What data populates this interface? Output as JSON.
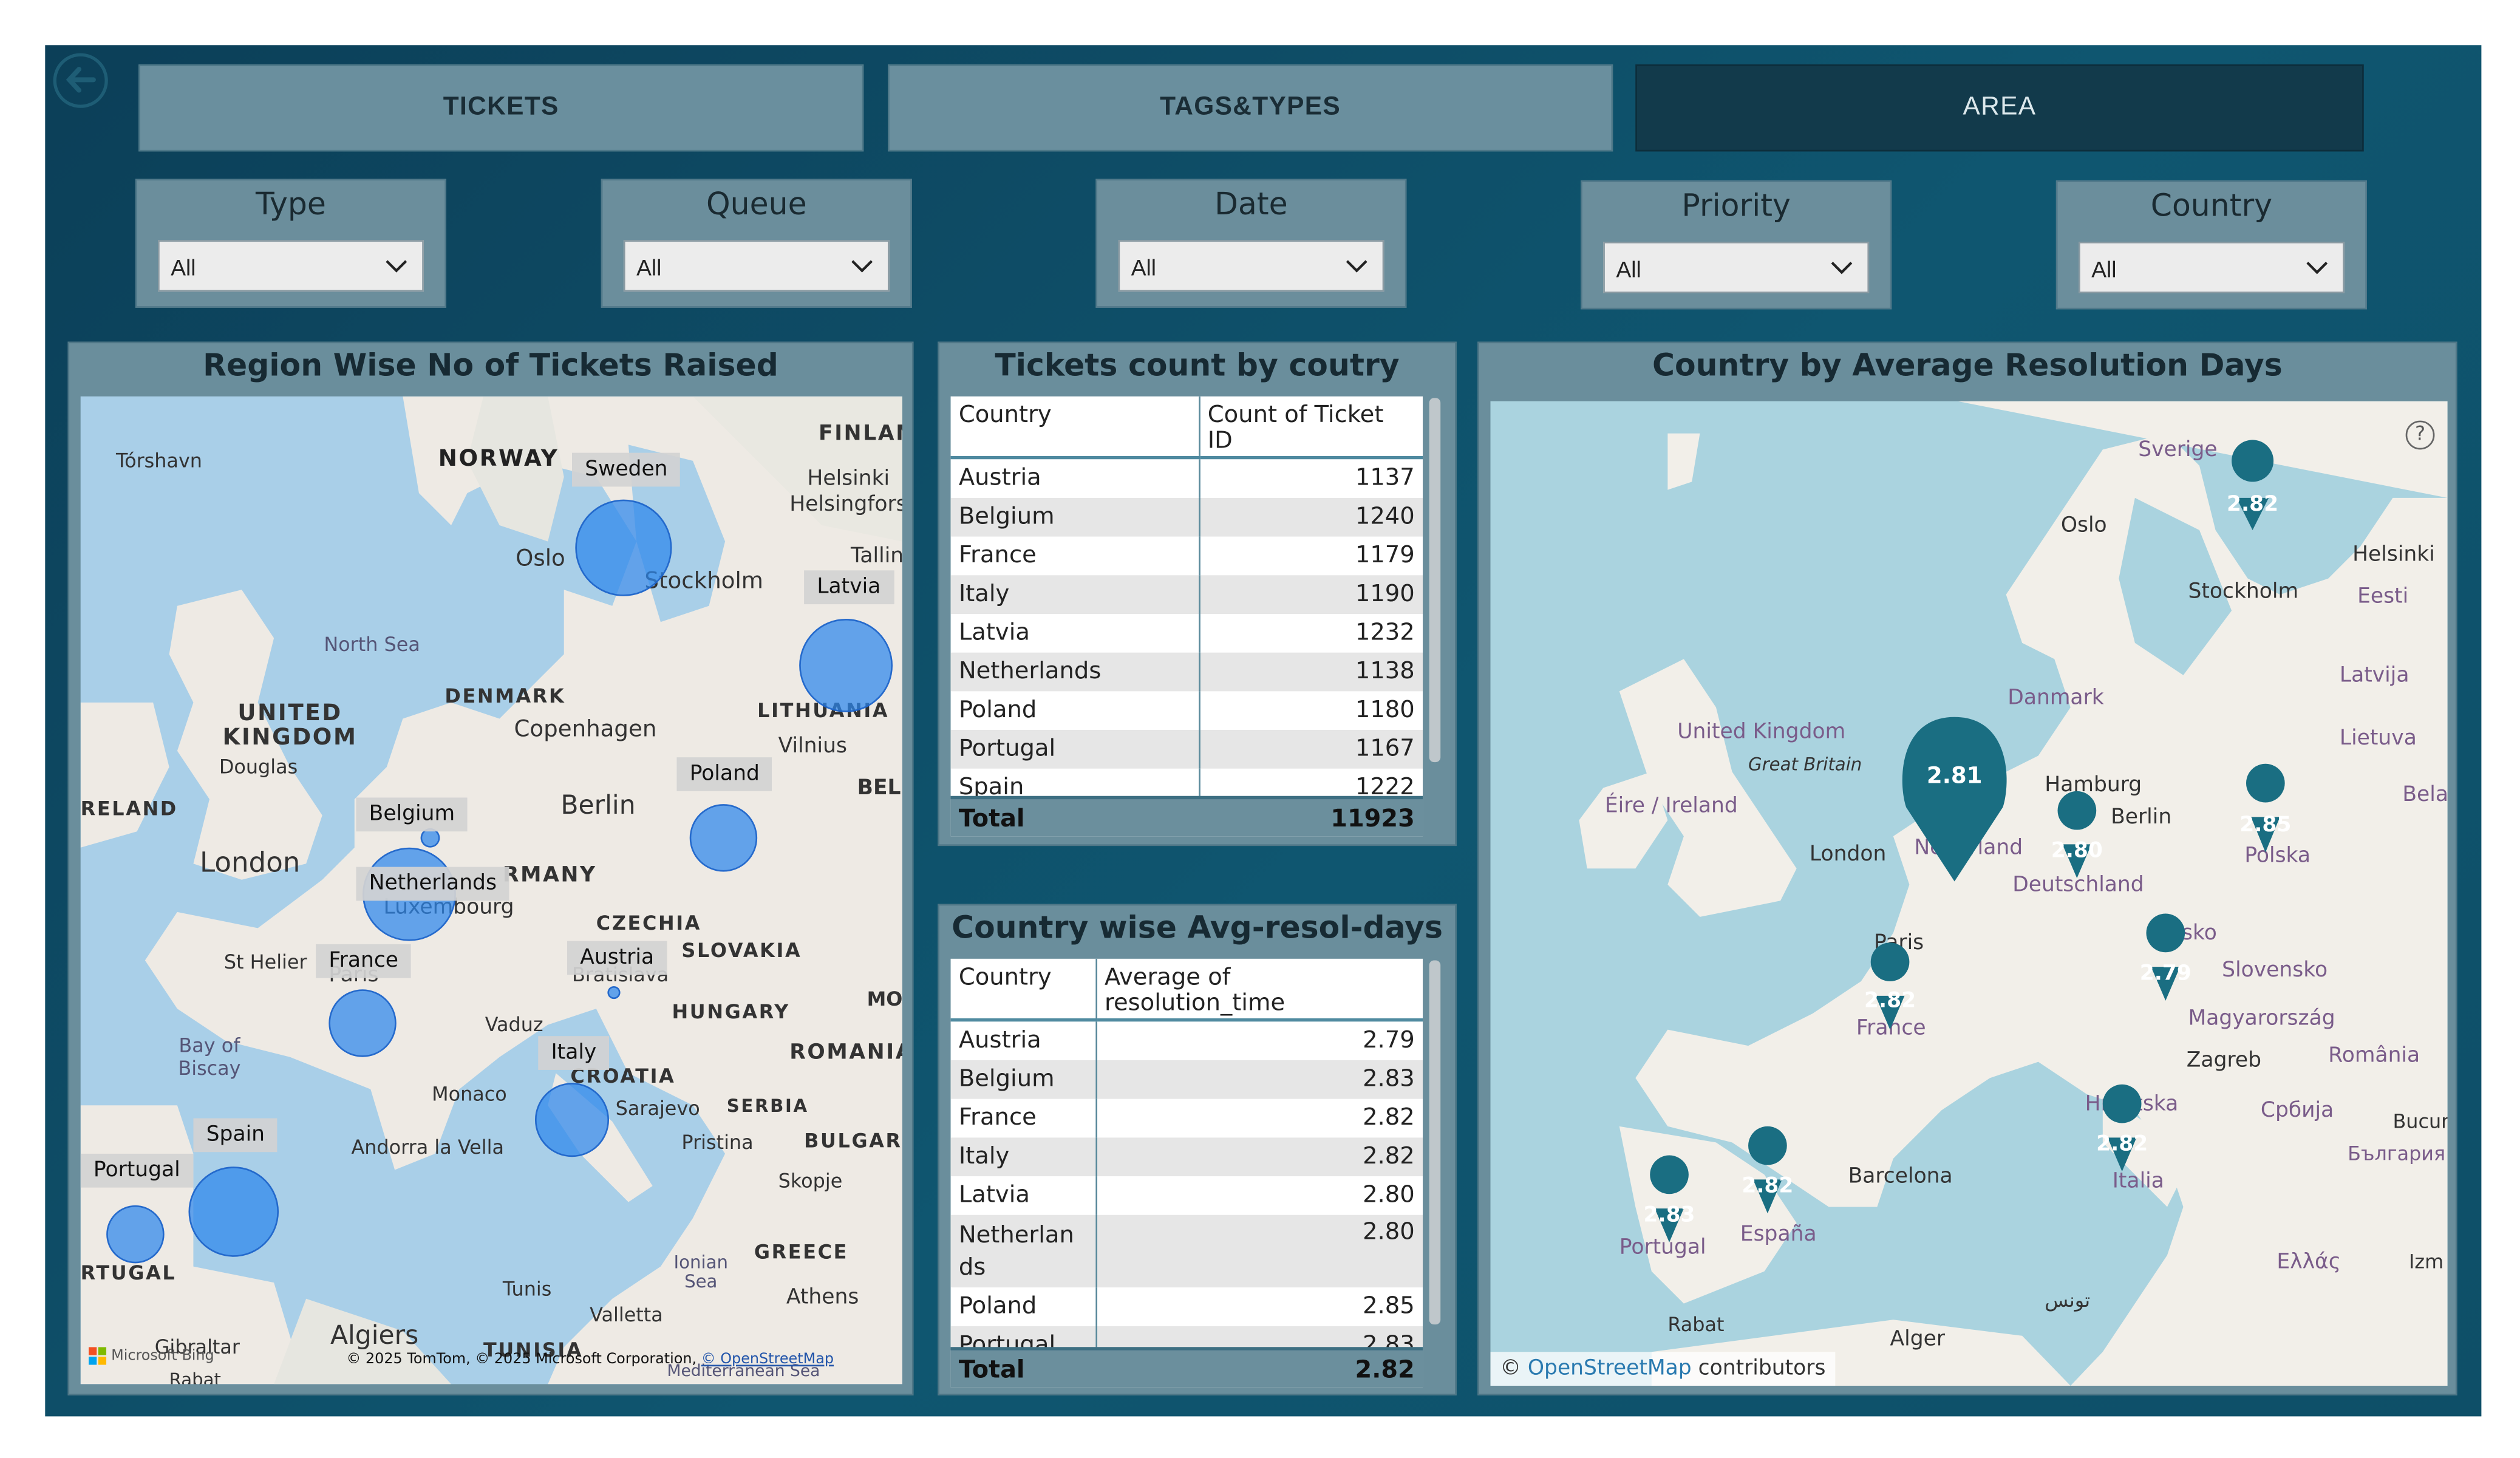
{
  "tabs": [
    {
      "label": "TICKETS",
      "active": false
    },
    {
      "label": "TAGS&TYPES",
      "active": false
    },
    {
      "label": "AREA",
      "active": true
    }
  ],
  "slicers": [
    {
      "title": "Type",
      "value": "All"
    },
    {
      "title": "Queue",
      "value": "All"
    },
    {
      "title": "Date",
      "value": "All"
    },
    {
      "title": "Priority",
      "value": "All"
    },
    {
      "title": "Country",
      "value": "All"
    }
  ],
  "region_map": {
    "title": "Region Wise No of Tickets Raised",
    "attribution": "© 2025 TomTom, © 2025 Microsoft Corporation,",
    "attribution_link": "© OpenStreetMap",
    "brand": "Microsoft Bing",
    "country_tags": [
      "Sweden",
      "Latvia",
      "Poland",
      "Belgium",
      "Netherlands",
      "France",
      "Austria",
      "Italy",
      "Spain",
      "Portugal"
    ],
    "place_labels": [
      "Tórshavn",
      "NORWAY",
      "FINLAN",
      "Helsinki",
      "Helsingfors",
      "Tallin",
      "Oslo",
      "Stockholm",
      "North Sea",
      "DENMARK",
      "Copenhagen",
      "LITHUANIA",
      "Vilnius",
      "UNITED KINGDOM",
      "Douglas",
      "RELAND",
      "BEL",
      "Berlin",
      "RMANY",
      "London",
      "Luxembourg",
      "CZECHIA",
      "SLOVAKIA",
      "Bratislava",
      "St Helier",
      "Paris",
      "Vaduz",
      "HUNGARY",
      "MO",
      "Bay of Biscay",
      "CROATIA",
      "ROMANIA",
      "Monaco",
      "Sarajevo",
      "SERBIA",
      "Andorra la Vella",
      "Pristina",
      "BULGARI",
      "Skopje",
      "RTUGAL",
      "GREECE",
      "Ionian Sea",
      "Tunis",
      "Athens",
      "Valletta",
      "Gibraltar",
      "Algiers",
      "TUNISIA",
      "Mediterranean Sea",
      "Rabat"
    ]
  },
  "tickets_table": {
    "title": "Tickets count by coutry",
    "columns": [
      "Country",
      "Count of Ticket ID"
    ],
    "rows": [
      [
        "Austria",
        "1137"
      ],
      [
        "Belgium",
        "1240"
      ],
      [
        "France",
        "1179"
      ],
      [
        "Italy",
        "1190"
      ],
      [
        "Latvia",
        "1232"
      ],
      [
        "Netherlands",
        "1138"
      ],
      [
        "Poland",
        "1180"
      ],
      [
        "Portugal",
        "1167"
      ],
      [
        "Spain",
        "1222"
      ]
    ],
    "total_label": "Total",
    "total_value": "11923"
  },
  "resol_table": {
    "title": "Country wise Avg-resol-days",
    "columns": [
      "Country",
      "Average of resolution_time"
    ],
    "rows": [
      [
        "Austria",
        "2.79"
      ],
      [
        "Belgium",
        "2.83"
      ],
      [
        "France",
        "2.82"
      ],
      [
        "Italy",
        "2.82"
      ],
      [
        "Latvia",
        "2.80"
      ],
      [
        "Netherlan ds",
        "2.80"
      ],
      [
        "Poland",
        "2.85"
      ],
      [
        "Portugal",
        "2.83"
      ]
    ],
    "total_label": "Total",
    "total_value": "2.82"
  },
  "avg_map": {
    "title": "Country by Average Resolution Days",
    "attribution_link": "OpenStreetMap",
    "attribution_rest": "contributors",
    "help_icon": "question-icon",
    "pins": [
      "2.82",
      "2.81",
      "2.80",
      "2.85",
      "2.79",
      "2.82",
      "2.82",
      "2.82",
      "2.83"
    ],
    "place_labels": [
      "Sverige",
      "Oslo",
      "Helsinki",
      "Stockholm",
      "Eesti",
      "Latvija",
      "Lietuva",
      "Danmark",
      "United Kingdom",
      "Great Britain",
      "Éire / Ireland",
      "Hamburg",
      "Berlin",
      "London",
      "Nederland",
      "Deutschland",
      "Polska",
      "Bela",
      "Paris",
      "Česko",
      "Slovensko",
      "France",
      "Magyarország",
      "Zagreb",
      "România",
      "Hrvatska",
      "Србија",
      "Bucureș",
      "България",
      "Italia",
      "Barcelona",
      "España",
      "Portugal",
      "Ελλάς",
      "Izm",
      "Rabat",
      "Alger",
      "تونس"
    ]
  },
  "colors": {
    "accent": "#1a6e82",
    "bubble": "#2d87eb",
    "panel": "#6a8e9c",
    "background": "#0f5670"
  }
}
